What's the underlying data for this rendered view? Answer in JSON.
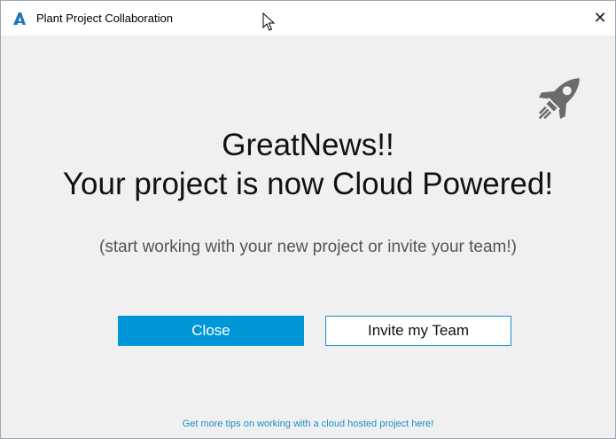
{
  "window": {
    "title": "Plant Project Collaboration",
    "close_glyph": "✕",
    "app_icon": "autodesk-a-icon"
  },
  "main": {
    "headline_line1": "GreatNews!!",
    "headline_line2": "Your project is now Cloud Powered!",
    "subtitle": "(start working with your new project or invite your team!)",
    "illustration_icon": "rocket-icon"
  },
  "buttons": {
    "close_label": "Close",
    "invite_label": "Invite my Team"
  },
  "footer": {
    "tips_link": "Get more tips on working with a cloud hosted project here!"
  },
  "colors": {
    "primary": "#0097d8",
    "link": "#1a8fcf",
    "rocket": "#6b6b6b"
  }
}
